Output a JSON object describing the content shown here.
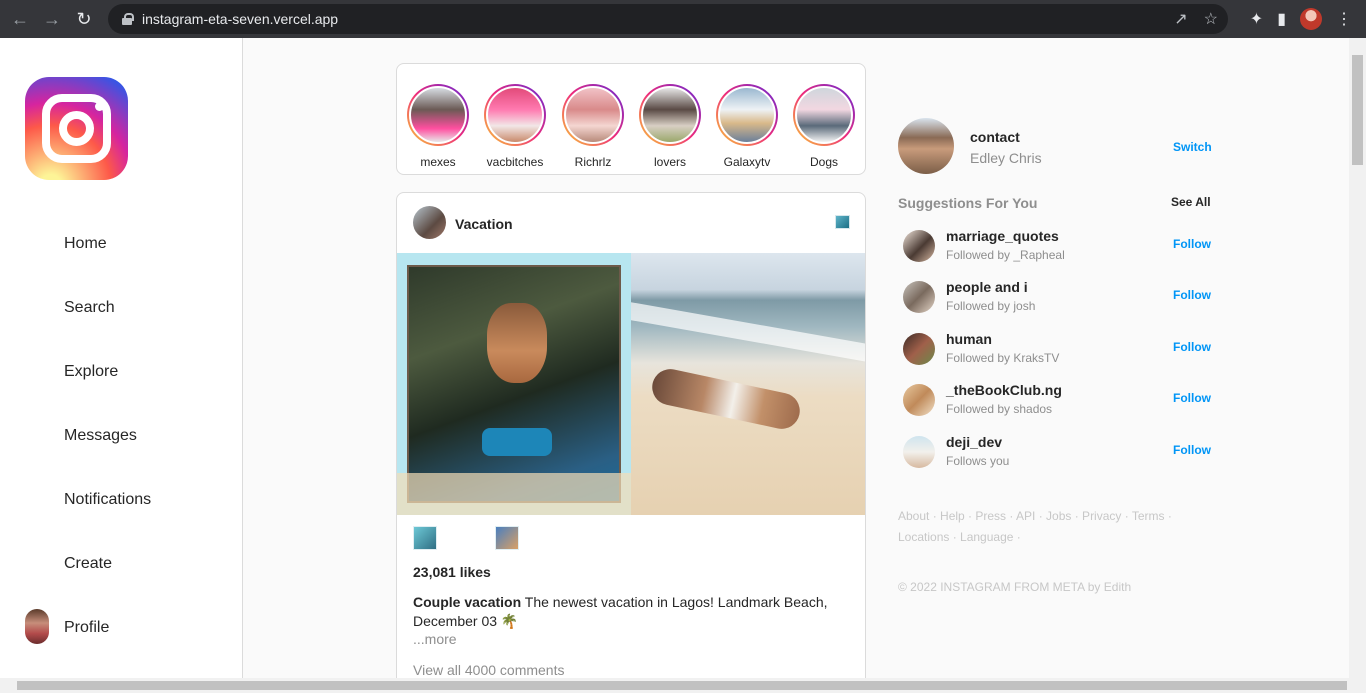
{
  "browser": {
    "url": "instagram-eta-seven.vercel.app"
  },
  "sidebar": {
    "items": [
      {
        "label": "Home"
      },
      {
        "label": "Search"
      },
      {
        "label": "Explore"
      },
      {
        "label": "Messages"
      },
      {
        "label": "Notifications"
      },
      {
        "label": "Create"
      },
      {
        "label": "Profile"
      }
    ]
  },
  "stories": [
    {
      "name": "mexes"
    },
    {
      "name": "vacbitches"
    },
    {
      "name": "Richrlz"
    },
    {
      "name": "lovers"
    },
    {
      "name": "Galaxytv"
    },
    {
      "name": "Dogs"
    }
  ],
  "post": {
    "username": "Vacation",
    "likes": "23,081 likes",
    "caption_user": "Couple vacation",
    "caption_text": " The newest vacation in Lagos! Landmark Beach, December 03 🌴",
    "more": "...more",
    "comments": "View all 4000 comments"
  },
  "profile": {
    "username": "contact",
    "name": "Edley Chris",
    "switch": "Switch"
  },
  "suggestions": {
    "title": "Suggestions For You",
    "see_all": "See All",
    "follow_label": "Follow",
    "items": [
      {
        "name": "marriage_quotes",
        "sub": "Followed by _Rapheal"
      },
      {
        "name": "people and i",
        "sub": "Followed by josh"
      },
      {
        "name": "human",
        "sub": "Followed by KraksTV"
      },
      {
        "name": "_theBookClub.ng",
        "sub": "Followed by shados"
      },
      {
        "name": "deji_dev",
        "sub": "Follows you"
      }
    ]
  },
  "footer": {
    "links": "About · Help · Press · API · Jobs · Privacy · Terms · Locations · Language ·",
    "copyright": "© 2022 INSTAGRAM FROM META by Edith"
  }
}
